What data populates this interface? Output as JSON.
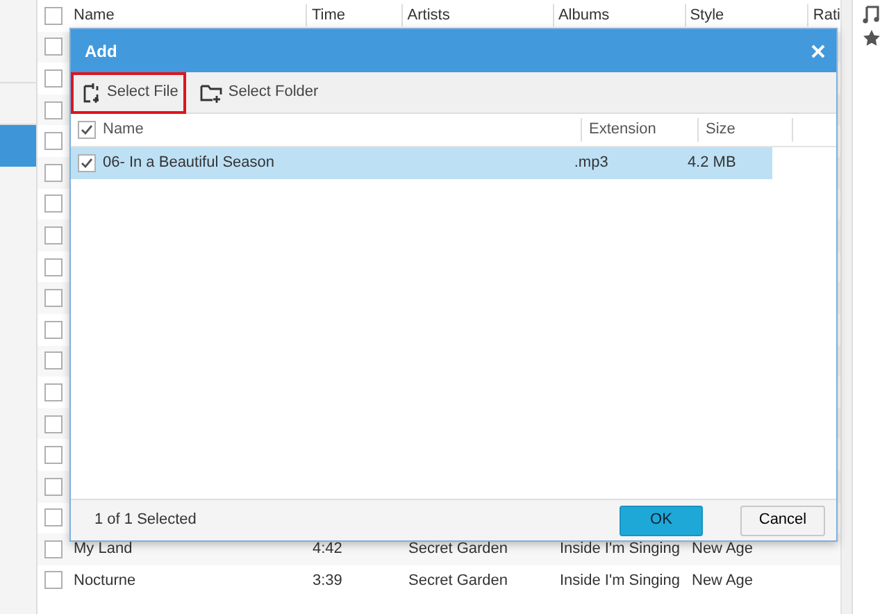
{
  "sidebar": {
    "items": [
      {
        "selected": false
      },
      {
        "selected": false
      },
      {
        "selected": true
      }
    ]
  },
  "table": {
    "header_checked": false,
    "columns": [
      "Name",
      "Time",
      "Artists",
      "Albums",
      "Style",
      "Rati"
    ],
    "rows": [
      {
        "checked": false
      },
      {
        "checked": false
      },
      {
        "checked": false
      },
      {
        "checked": false
      },
      {
        "checked": false
      },
      {
        "checked": false
      },
      {
        "checked": false
      },
      {
        "checked": false
      },
      {
        "checked": false
      },
      {
        "checked": false
      },
      {
        "checked": false
      },
      {
        "checked": false
      },
      {
        "checked": false
      },
      {
        "checked": false
      },
      {
        "checked": false
      },
      {
        "checked": false
      },
      {
        "checked": false,
        "cells": [
          "My Land",
          "4:42",
          "Secret Garden",
          "Inside I'm Singing",
          "New Age"
        ]
      },
      {
        "checked": false,
        "cells": [
          "Nocturne",
          "3:39",
          "Secret Garden",
          "Inside I'm Singing",
          "New Age"
        ]
      }
    ]
  },
  "dialog": {
    "title": "Add",
    "toolbar": [
      {
        "label": "Select File",
        "kind": "file",
        "highlighted": true
      },
      {
        "label": "Select Folder",
        "kind": "folder",
        "highlighted": false
      }
    ],
    "file_list": {
      "header_checked": true,
      "columns": [
        "Name",
        "Extension",
        "Size"
      ],
      "files": [
        {
          "name": "06- In a Beautiful Season",
          "extension": ".mp3",
          "size": "4.2 MB",
          "checked": true,
          "selected": true
        }
      ]
    },
    "status": "1 of 1 Selected",
    "buttons": [
      {
        "label": "OK",
        "kind": "primary"
      },
      {
        "label": "Cancel",
        "kind": "secondary"
      }
    ]
  }
}
